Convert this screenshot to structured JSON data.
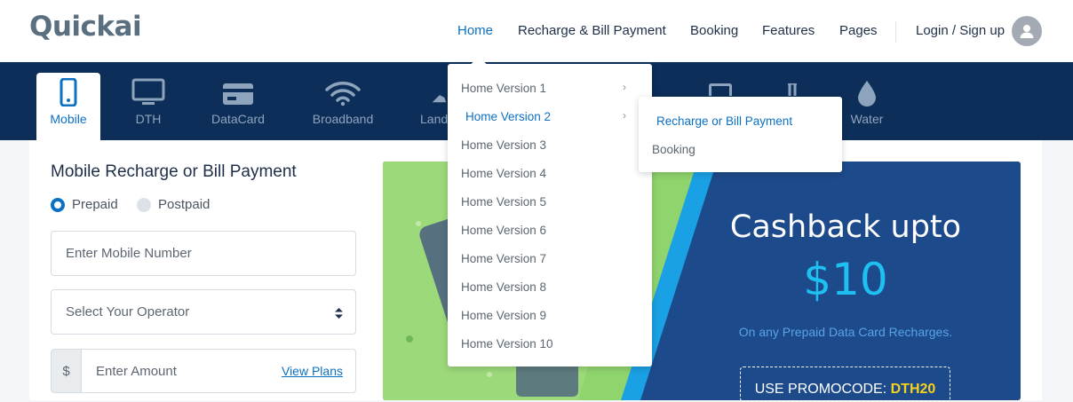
{
  "brand": {
    "logo_text": "Quickai"
  },
  "nav": {
    "items": [
      "Home",
      "Recharge & Bill Payment",
      "Booking",
      "Features",
      "Pages"
    ],
    "login_label": "Login / Sign up"
  },
  "services": [
    {
      "label": "Mobile",
      "icon": "mobile-icon"
    },
    {
      "label": "DTH",
      "icon": "tv-icon"
    },
    {
      "label": "DataCard",
      "icon": "datacard-icon"
    },
    {
      "label": "Broadband",
      "icon": "wifi-icon"
    },
    {
      "label": "Land",
      "icon": "phone-icon"
    },
    {
      "label": "Water",
      "icon": "water-drop-icon"
    }
  ],
  "form": {
    "title": "Mobile Recharge or Bill Payment",
    "radio_prepaid": "Prepaid",
    "radio_postpaid": "Postpaid",
    "mobile_placeholder": "Enter Mobile Number",
    "operator_placeholder": "Select Your Operator",
    "currency_symbol": "$",
    "amount_placeholder": "Enter Amount",
    "view_plans": "View Plans"
  },
  "banner": {
    "title": "Cashback upto",
    "amount": "$10",
    "subtitle": "On any Prepaid Data Card Recharges.",
    "promo_label": "USE PROMOCODE:",
    "promo_code": "DTH20"
  },
  "home_dropdown": {
    "items": [
      "Home Version 1",
      "Home Version 2",
      "Home Version 3",
      "Home Version 4",
      "Home Version 5",
      "Home Version 6",
      "Home Version 7",
      "Home Version 8",
      "Home Version 9",
      "Home Version 10"
    ],
    "submenu": [
      "Recharge or Bill Payment",
      "Booking"
    ]
  },
  "colors": {
    "accent": "#0c71c3",
    "navy": "#0c2e58",
    "promo": "#f7d21b",
    "cashback": "#1ec0f2"
  }
}
